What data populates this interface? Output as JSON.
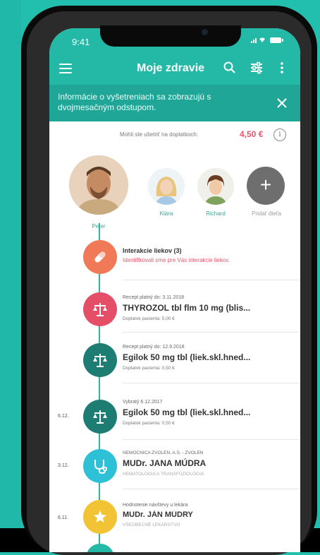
{
  "status": {
    "time": "9:41"
  },
  "appbar": {
    "title": "Moje zdravie"
  },
  "banner": {
    "text": "Informácie o vyšetreniach sa zobrazujú s dvojmesačným odstupom."
  },
  "savings": {
    "label": "Mohli ste ušetriť na doplatkoch:",
    "value": "4,50 €"
  },
  "profiles": [
    {
      "name": "Peter"
    },
    {
      "name": "Klára"
    },
    {
      "name": "Richard"
    },
    {
      "name": "Pridať dieťa"
    }
  ],
  "timeline": [
    {
      "date": "",
      "meta": "",
      "title": "Interakcie liekov (3)",
      "sub": "Identifikovali sme pre Vás interakcie liekov.",
      "color": "#f07a57",
      "icon": "pill-icon"
    },
    {
      "date": "",
      "meta": "Recept platný do: 3.11.2018",
      "title": "THYROZOL tbl flm 10 mg (blis...",
      "sub": "Doplatok pacienta: 5,00 €",
      "color": "#e44f67",
      "icon": "scale-icon"
    },
    {
      "date": "",
      "meta": "Recept platný do: 12.9.2018",
      "title": "Egilok 50 mg tbl (liek.skl.hned...",
      "sub": "Doplatok pacienta: 0,50 €",
      "color": "#1d7d73",
      "icon": "scale-icon"
    },
    {
      "date": "6.12.",
      "meta": "Vybratý 6.12.2017",
      "title": "Egilok 50 mg tbl (liek.skl.hned...",
      "sub": "Doplatok pacienta: 0,50 €",
      "color": "#1d7d73",
      "icon": "scale-icon"
    },
    {
      "date": "3.12.",
      "meta": "NEMOCNICA ZVOLEN, A.S. - ZVOLEN",
      "title": "MUDr. JANA MÚDRA",
      "sub": "HEMATOLÓGIA A TRANSFÚZIOLÓGIA",
      "color": "#2ec0d6",
      "icon": "stethoscope-icon"
    },
    {
      "date": "6.11.",
      "meta": "Hodnotenie návštevy u lekára",
      "title": "MUDr. JÁN MÚDRY",
      "sub": "VŠEOBECNÉ LEKÁRSTVO",
      "color": "#f2c335",
      "icon": "star-icon"
    }
  ]
}
